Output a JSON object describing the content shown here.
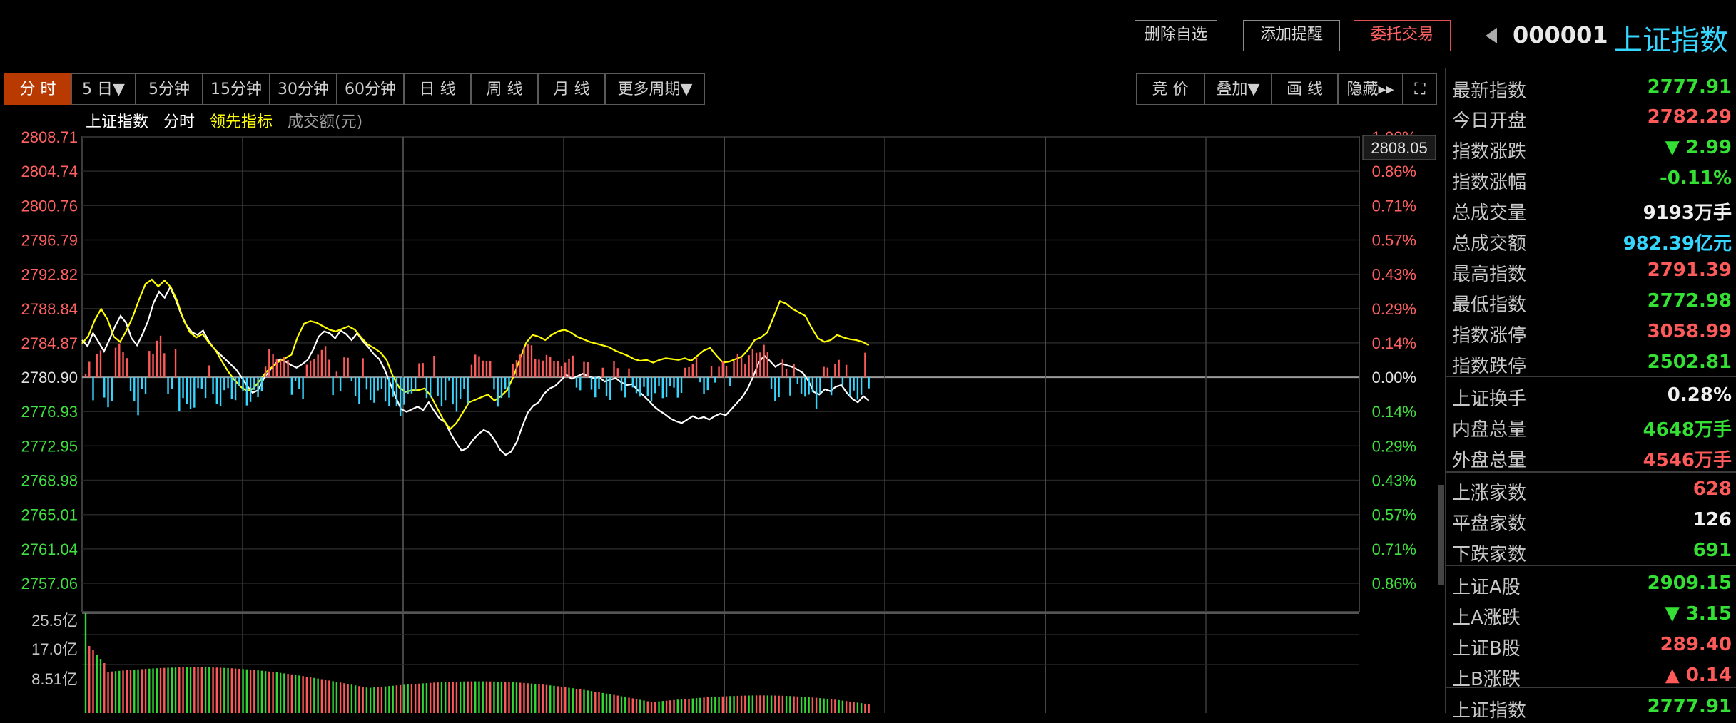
{
  "header": {
    "buttons": [
      "删除自选",
      "添加提醒",
      "委托交易"
    ],
    "code": "000001",
    "name": "上证指数",
    "back_arrow": "left-triangle-icon"
  },
  "period_tabs": [
    "分 时",
    "5 日▼",
    "5分钟",
    "15分钟",
    "30分钟",
    "60分钟",
    "日 线",
    "周 线",
    "月 线",
    "更多周期▼"
  ],
  "tool_tabs": [
    "竞 价",
    "叠加▼",
    "画 线",
    "隐藏▸▸",
    "⛶"
  ],
  "legend": [
    "上证指数",
    "分时",
    "领先指标",
    "成交额(元)"
  ],
  "chart_data": {
    "type": "line",
    "title": "上证指数 分时",
    "y_price_ticks": [
      "2808.71",
      "2804.74",
      "2800.76",
      "2796.79",
      "2792.82",
      "2788.84",
      "2784.87",
      "2780.90",
      "2776.93",
      "2772.95",
      "2768.98",
      "2765.01",
      "2761.04",
      "2757.06"
    ],
    "y_pct_ticks": [
      "1.00%",
      "0.86%",
      "0.71%",
      "0.57%",
      "0.43%",
      "0.29%",
      "0.14%",
      "0.00%",
      "0.14%",
      "0.29%",
      "0.43%",
      "0.57%",
      "0.71%",
      "0.86%"
    ],
    "current_price_label": "2808.05",
    "prev_close": 2780.9,
    "ylim": [
      2757.06,
      2808.71
    ],
    "volume_ticks": [
      "25.5亿",
      "17.0亿",
      "8.51亿"
    ],
    "series": [
      {
        "name": "分时",
        "color": "#ffffff",
        "values": [
          2785.2,
          2784.5,
          2786.0,
          2785.0,
          2783.9,
          2785.3,
          2786.8,
          2788.0,
          2787.2,
          2785.4,
          2784.6,
          2785.9,
          2787.4,
          2789.5,
          2790.8,
          2790.1,
          2791.3,
          2789.9,
          2788.2,
          2786.9,
          2786.1,
          2785.8,
          2786.3,
          2785.1,
          2784.2,
          2783.6,
          2783.0,
          2782.4,
          2781.8,
          2780.9,
          2779.9,
          2779.1,
          2779.4,
          2780.7,
          2781.6,
          2782.4,
          2783.0,
          2782.7,
          2782.3,
          2782.0,
          2782.4,
          2782.9,
          2784.1,
          2785.6,
          2786.2,
          2786.0,
          2785.4,
          2786.3,
          2785.9,
          2785.2,
          2786.0,
          2785.1,
          2784.4,
          2783.6,
          2783.0,
          2781.8,
          2780.2,
          2778.6,
          2777.2,
          2776.9,
          2777.2,
          2777.5,
          2777.1,
          2778.0,
          2777.0,
          2776.1,
          2775.7,
          2774.4,
          2773.3,
          2772.4,
          2772.7,
          2773.6,
          2774.3,
          2774.8,
          2774.5,
          2773.6,
          2772.5,
          2771.9,
          2772.3,
          2773.4,
          2775.2,
          2776.8,
          2777.6,
          2778.0,
          2779.0,
          2779.6,
          2779.9,
          2780.5,
          2781.2,
          2780.7,
          2781.0,
          2781.3,
          2781.0,
          2780.8,
          2780.9,
          2780.4,
          2780.6,
          2780.8,
          2780.3,
          2780.0,
          2780.1,
          2779.4,
          2778.8,
          2778.2,
          2777.5,
          2777.0,
          2776.6,
          2776.1,
          2775.8,
          2775.6,
          2776.0,
          2776.4,
          2776.1,
          2776.3,
          2776.0,
          2776.4,
          2776.7,
          2776.5,
          2777.2,
          2777.9,
          2778.6,
          2779.6,
          2781.0,
          2782.6,
          2783.4,
          2782.8,
          2782.1,
          2782.5,
          2782.3,
          2782.1,
          2781.8,
          2781.4,
          2780.5,
          2779.2,
          2778.9,
          2779.5,
          2779.3,
          2779.8,
          2780.0,
          2779.1,
          2778.4,
          2778.0,
          2778.7,
          2778.2
        ],
        "x_fraction": 0.616
      },
      {
        "name": "领先指标",
        "color": "#ffff00",
        "values": [
          2784.8,
          2785.7,
          2787.5,
          2788.8,
          2787.6,
          2785.6,
          2785.0,
          2786.3,
          2787.9,
          2789.9,
          2791.7,
          2792.2,
          2791.4,
          2792.1,
          2791.3,
          2789.7,
          2787.5,
          2786.1,
          2785.5,
          2785.9,
          2784.9,
          2784.1,
          2782.8,
          2781.6,
          2780.6,
          2779.8,
          2779.3,
          2779.6,
          2780.5,
          2781.5,
          2782.1,
          2782.7,
          2783.1,
          2783.5,
          2785.6,
          2787.1,
          2787.4,
          2787.2,
          2786.8,
          2786.4,
          2786.2,
          2786.5,
          2786.8,
          2786.4,
          2785.5,
          2784.7,
          2784.3,
          2783.8,
          2782.9,
          2781.0,
          2779.7,
          2779.2,
          2779.4,
          2779.4,
          2779.6,
          2778.7,
          2777.3,
          2775.9,
          2774.9,
          2775.6,
          2776.8,
          2778.0,
          2778.3,
          2778.6,
          2778.9,
          2778.2,
          2778.7,
          2779.4,
          2781.0,
          2783.0,
          2784.9,
          2785.8,
          2785.6,
          2785.2,
          2785.8,
          2786.2,
          2786.4,
          2786.1,
          2785.6,
          2785.3,
          2785.0,
          2784.8,
          2784.6,
          2784.4,
          2784.0,
          2783.7,
          2783.4,
          2783.0,
          2782.8,
          2782.9,
          2782.6,
          2782.9,
          2783.1,
          2783.0,
          2782.9,
          2783.1,
          2782.8,
          2783.4,
          2784.0,
          2784.3,
          2783.4,
          2782.6,
          2782.7,
          2783.0,
          2783.3,
          2784.1,
          2785.2,
          2785.5,
          2786.1,
          2787.9,
          2789.7,
          2789.4,
          2788.8,
          2788.4,
          2788.0,
          2786.6,
          2785.4,
          2785.0,
          2785.2,
          2785.8,
          2785.5,
          2785.3,
          2785.2,
          2785.0,
          2784.6
        ],
        "x_fraction": 0.616
      }
    ]
  },
  "sidebar": {
    "rows": [
      {
        "label": "最新指数",
        "value": "2777.91",
        "color": "dn"
      },
      {
        "label": "今日开盘",
        "value": "2782.29",
        "color": "up"
      },
      {
        "label": "指数涨跌",
        "value": "▼ 2.99",
        "color": "dn"
      },
      {
        "label": "指数涨幅",
        "value": "-0.11%",
        "color": "dn"
      },
      {
        "label": "总成交量",
        "value": "9193万手",
        "color": "wh"
      },
      {
        "label": "总成交额",
        "value": "982.39亿元",
        "color": "cy"
      },
      {
        "label": "最高指数",
        "value": "2791.39",
        "color": "up"
      },
      {
        "label": "最低指数",
        "value": "2772.98",
        "color": "dn"
      },
      {
        "label": "指数涨停",
        "value": "3058.99",
        "color": "up"
      },
      {
        "label": "指数跌停",
        "value": "2502.81",
        "color": "dn"
      },
      {
        "label": "上证换手",
        "value": "0.28%",
        "color": "wh"
      },
      {
        "label": "内盘总量",
        "value": "4648万手",
        "color": "dn"
      },
      {
        "label": "外盘总量",
        "value": "4546万手",
        "color": "up"
      },
      {
        "label": "上涨家数",
        "value": "628",
        "color": "up"
      },
      {
        "label": "平盘家数",
        "value": "126",
        "color": "wh"
      },
      {
        "label": "下跌家数",
        "value": "691",
        "color": "dn"
      },
      {
        "label": "上证A股",
        "value": "2909.15",
        "color": "dn"
      },
      {
        "label": "上A涨跌",
        "value": "▼ 3.15",
        "color": "dn"
      },
      {
        "label": "上证B股",
        "value": "289.40",
        "color": "up"
      },
      {
        "label": "上B涨跌",
        "value": "▲ 0.14",
        "color": "up"
      },
      {
        "label": "上证指数",
        "value": "2777.91",
        "color": "dn"
      }
    ]
  }
}
